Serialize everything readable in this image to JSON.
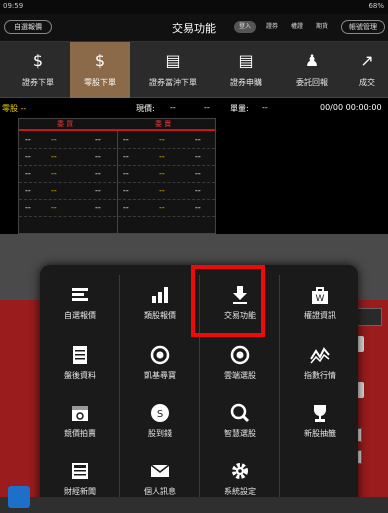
{
  "status_bar": {
    "time": "09:59",
    "battery": "68%"
  },
  "header": {
    "left_pill": "自選報價",
    "title": "交易功能",
    "segments": [
      "登入",
      "證券",
      "權證",
      "期貨"
    ],
    "right_pill": "帳號管理"
  },
  "toolbar": {
    "items": [
      {
        "label": "證券下單",
        "icon": "dollar-icon",
        "active": false
      },
      {
        "label": "零股下單",
        "icon": "dollar-icon",
        "active": true
      },
      {
        "label": "證券當沖下單",
        "icon": "notebook-icon",
        "active": false
      },
      {
        "label": "證券申購",
        "icon": "notebook-icon",
        "active": false
      },
      {
        "label": "委託回報",
        "icon": "person-icon",
        "active": false
      },
      {
        "label": "成交",
        "icon": "chart-icon",
        "active": false
      }
    ]
  },
  "quote": {
    "symbol": "零股 --",
    "price_label": "現價:",
    "price_value": "--",
    "change_value": "--",
    "volume_label": "單量:",
    "volume_value": "--",
    "datetime": "00/00 00:00:00"
  },
  "order_book": {
    "headers": [
      "委 買",
      "委 賣"
    ],
    "rows": [
      [
        "--",
        "--",
        "--",
        "--",
        "--",
        "--"
      ],
      [
        "--",
        "--",
        "--",
        "--",
        "--",
        "--"
      ],
      [
        "--",
        "--",
        "--",
        "--",
        "--",
        "--"
      ],
      [
        "--",
        "--",
        "--",
        "--",
        "--",
        "--"
      ],
      [
        "--",
        "--",
        "--",
        "--",
        "--",
        "--"
      ]
    ]
  },
  "menu": {
    "rows": [
      [
        {
          "label": "自選報價",
          "icon": "list-edit-icon"
        },
        {
          "label": "類股報價",
          "icon": "bar-chart-icon"
        },
        {
          "label": "交易功能",
          "icon": "download-arrow-icon"
        },
        {
          "label": "權證資訊",
          "icon": "warrant-bag-icon"
        }
      ],
      [
        {
          "label": "盤後資料",
          "icon": "document-icon"
        },
        {
          "label": "凱基尋寶",
          "icon": "target-icon"
        },
        {
          "label": "雲端選股",
          "icon": "target-icon"
        },
        {
          "label": "指數行情",
          "icon": "line-chart-icon"
        }
      ],
      [
        {
          "label": "競價拍賣",
          "icon": "calendar-icon"
        },
        {
          "label": "股到錢",
          "icon": "stock-coin-icon"
        },
        {
          "label": "智慧選股",
          "icon": "magnifier-icon"
        },
        {
          "label": "新股抽籤",
          "icon": "trophy-icon"
        }
      ],
      [
        {
          "label": "財經新聞",
          "icon": "news-icon"
        },
        {
          "label": "個人訊息",
          "icon": "envelope-icon"
        },
        {
          "label": "系統設定",
          "icon": "gear-icon"
        }
      ]
    ]
  },
  "colors": {
    "accent_red": "#ee0a0a",
    "active_tab": "#8a6a49",
    "background_red": "#9a1c1c"
  }
}
